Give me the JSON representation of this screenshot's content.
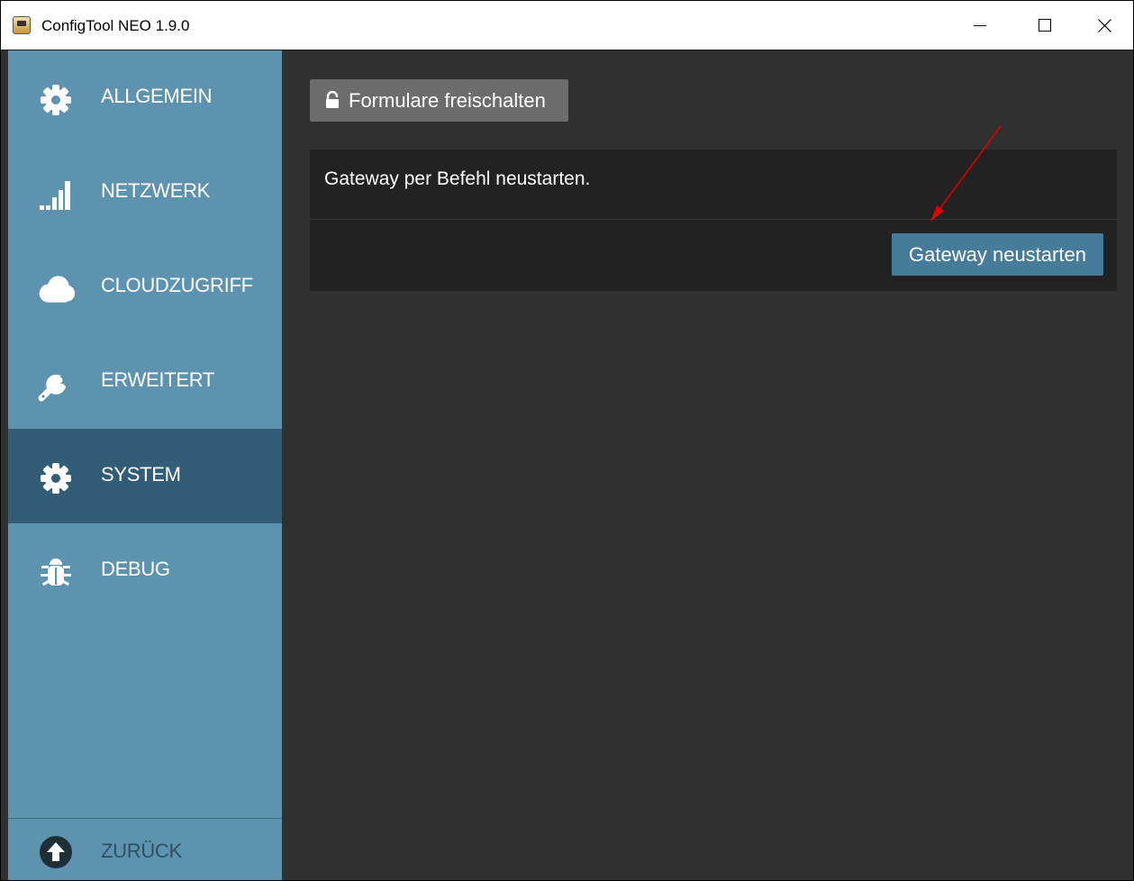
{
  "window": {
    "title": "ConfigTool NEO 1.9.0"
  },
  "sidebar": {
    "items": [
      {
        "label": "ALLGEMEIN",
        "icon": "gear-icon",
        "active": false
      },
      {
        "label": "NETZWERK",
        "icon": "signal-bars-icon",
        "active": false
      },
      {
        "label": "CLOUDZUGRIFF",
        "icon": "cloud-icon",
        "active": false
      },
      {
        "label": "ERWEITERT",
        "icon": "wrench-icon",
        "active": false
      },
      {
        "label": "SYSTEM",
        "icon": "gear-icon",
        "active": true
      },
      {
        "label": "DEBUG",
        "icon": "bug-icon",
        "active": false
      }
    ],
    "back": {
      "label": "ZURÜCK",
      "icon": "arrow-up-circle-icon"
    }
  },
  "main": {
    "unlock_button": {
      "label": "Formulare freischalten",
      "icon": "unlock-icon"
    },
    "panel": {
      "text": "Gateway per Befehl neustarten.",
      "button_label": "Gateway neustarten"
    }
  },
  "colors": {
    "sidebar": "#5e93b0",
    "sidebar_active": "#335d76",
    "main_background": "#303030",
    "panel_background": "#222222",
    "primary_button": "#467c99",
    "unlock_button": "#6c6c6c",
    "annotation_arrow": "#e00000"
  }
}
